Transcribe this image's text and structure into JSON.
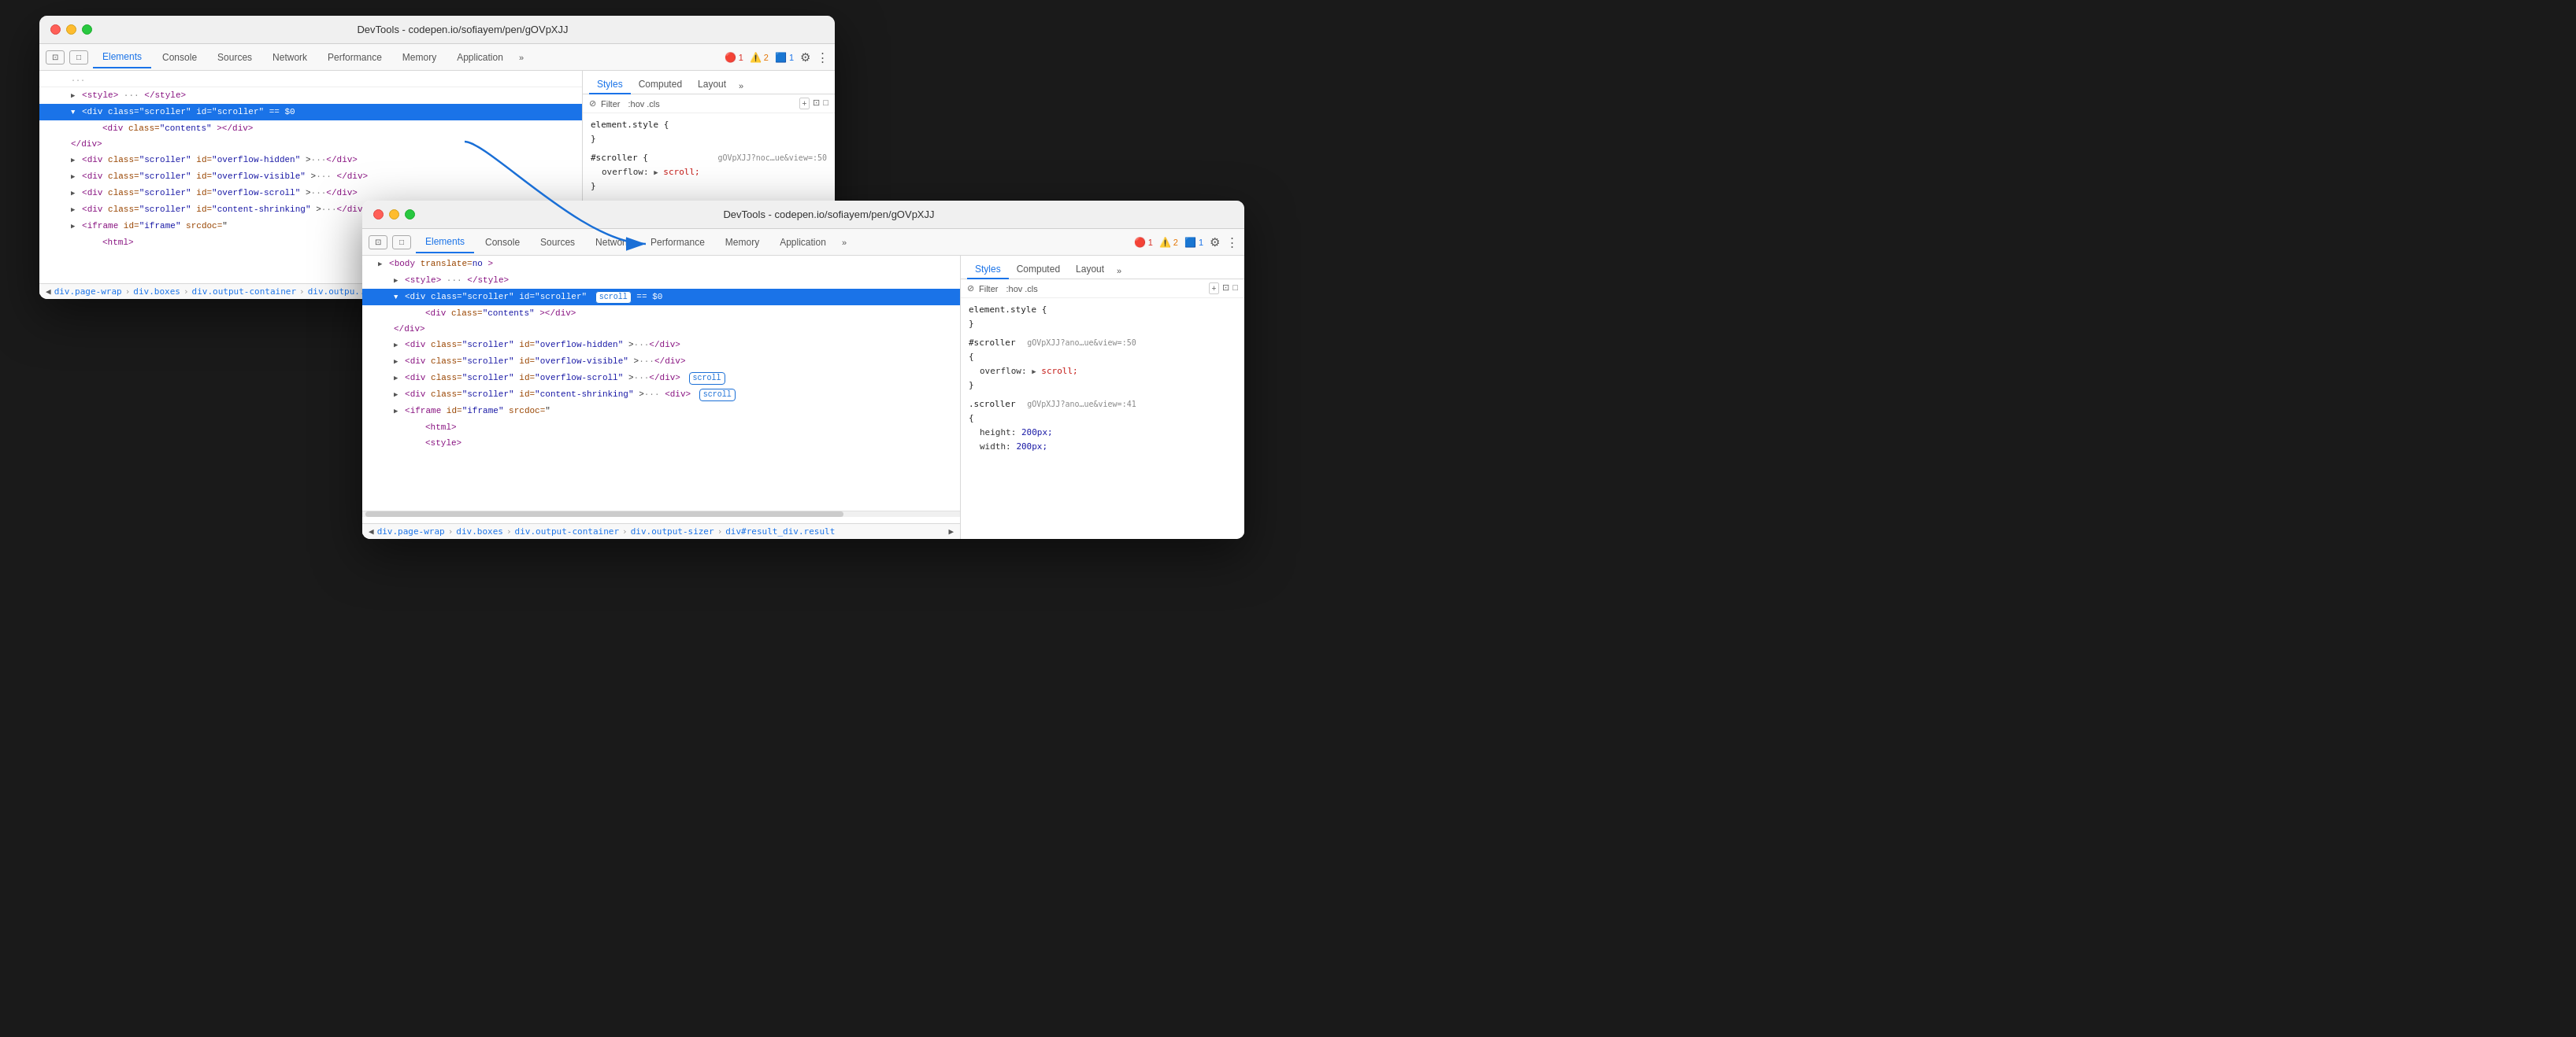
{
  "window1": {
    "title": "DevTools - codepen.io/sofiayem/pen/gOVpXJJ",
    "tabs": [
      "Elements",
      "Console",
      "Sources",
      "Network",
      "Performance",
      "Memory",
      "Application"
    ],
    "activeTab": "Elements",
    "errors": {
      "red": "1",
      "orange": "2",
      "blue": "1"
    },
    "dom": [
      {
        "indent": 0,
        "content": "▶ <style>··· </style>",
        "selected": false
      },
      {
        "indent": 0,
        "content": "▼ <div class=\"scroller\" id=\"scroller\"> == $0",
        "selected": true
      },
      {
        "indent": 1,
        "content": "<div class=\"contents\"></div>",
        "selected": false
      },
      {
        "indent": 0,
        "content": "</div>",
        "selected": false
      },
      {
        "indent": 0,
        "content": "▶ <div class=\"scroller\" id=\"overflow-hidden\">··· </div>",
        "selected": false
      },
      {
        "indent": 0,
        "content": "▶ <div class=\"scroller\" id=\"overflow-visible\">··· </div>",
        "selected": false
      },
      {
        "indent": 0,
        "content": "▶ <div class=\"scroller\" id=\"overflow-scroll\">··· </div>",
        "selected": false
      },
      {
        "indent": 0,
        "content": "▶ <div class=\"scroller\" id=\"content-shrinking\">··· </div>",
        "selected": false
      },
      {
        "indent": 0,
        "content": "▶ <iframe id=\"iframe\" srcdoc=\"",
        "selected": false
      },
      {
        "indent": 1,
        "content": "<html>",
        "selected": false
      }
    ],
    "breadcrumbs": [
      "div.page-wrap",
      "div.boxes",
      "div.output-container",
      "div.outpu..."
    ],
    "styles": {
      "filterPlaceholder": ":hov .cls",
      "rules": [
        {
          "selector": "element.style {",
          "close": "}",
          "props": []
        },
        {
          "selector": "#scroller {",
          "link": "gOVpXJJ?noc...ue&view=:50",
          "props": [
            {
              "name": "overflow:",
              "value": "▶ scroll;",
              "color": "red"
            }
          ],
          "close": "}"
        }
      ]
    }
  },
  "window2": {
    "title": "DevTools - codepen.io/sofiayem/pen/gOVpXJJ",
    "tabs": [
      "Elements",
      "Console",
      "Sources",
      "Network",
      "Performance",
      "Memory",
      "Application"
    ],
    "activeTab": "Elements",
    "errors": {
      "red": "1",
      "orange": "2",
      "blue": "1"
    },
    "dom": [
      {
        "indent": 0,
        "content": "▶ <body translate=no >"
      },
      {
        "indent": 0,
        "content": "▶ <style>··· </style>"
      },
      {
        "indent": 0,
        "content": "▼ <div class=\"scroller\" id=\"scroller\"",
        "badge": "scroll",
        "suffix": "== $0"
      },
      {
        "indent": 1,
        "content": "<div class=\"contents\"></div>"
      },
      {
        "indent": 0,
        "content": "</div>"
      },
      {
        "indent": 0,
        "content": "▶ <div class=\"scroller\" id=\"overflow-hidden\">··· </div>"
      },
      {
        "indent": 0,
        "content": "▶ <div class=\"scroller\" id=\"overflow-visible\">··· </div>"
      },
      {
        "indent": 0,
        "content": "▶ <div class=\"scroller\" id=\"overflow-scroll\">···</div>",
        "badge": "scroll"
      },
      {
        "indent": 0,
        "content": "▶ <div class=\"scroller\" id=\"content-shrinking\">···</div>",
        "badge2": "scroll"
      },
      {
        "indent": 0,
        "content": "▶ <iframe id=\"iframe\" srcdoc=\""
      },
      {
        "indent": 1,
        "content": "<html>"
      },
      {
        "indent": 1,
        "content": "<style>"
      }
    ],
    "breadcrumbs": [
      "div.page-wrap",
      "div.boxes",
      "div.output-container",
      "div.output-sizer",
      "div#result_div.result"
    ],
    "styles": {
      "filterPlaceholder": ":hov .cls",
      "rules": [
        {
          "selector": "element.style {",
          "close": "}",
          "props": []
        },
        {
          "selector": "#scroller",
          "link": "gOVpXJJ?ano...ue&view=:50",
          "props": [
            {
              "name": "overflow:",
              "value": "▶ scroll;",
              "color": "red"
            }
          ],
          "close": "}"
        },
        {
          "selector": ".scroller",
          "link": "gOVpXJJ?ano...ue&view=:41",
          "props": [
            {
              "name": "height:",
              "value": "200px;"
            },
            {
              "name": "width:",
              "value": "200px;"
            }
          ],
          "close": ""
        }
      ]
    }
  },
  "arrow": {
    "label": "blue arrow pointing from window1 to window2"
  },
  "labels": {
    "filter": "Filter",
    "hov_cls": ":hov .cls",
    "element_style": "element.style {",
    "close_brace": "}",
    "overflow": "overflow:",
    "scroll_val": "▶ scroll;",
    "styles_tab": "Styles",
    "computed_tab": "Computed",
    "layout_tab": "Layout",
    "more": "»",
    "gear": "⚙",
    "more_vert": "⋮",
    "scroll_badge": "scroll",
    "height_prop": "height:",
    "height_val": "200px;",
    "width_prop": "width:",
    "width_val": "200px;"
  }
}
